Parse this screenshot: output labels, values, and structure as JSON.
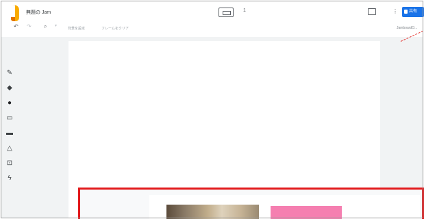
{
  "app": {
    "doc_title": "無題の Jam",
    "slide_count": "1"
  },
  "toolbar": {
    "undo_icon": "undo-icon",
    "redo_icon": "redo-icon",
    "zoom_icon": "zoom-icon",
    "set_background_label": "背景を設定",
    "clear_frame_label": "フレームをクリア",
    "right_label": "JamboardO..."
  },
  "header": {
    "share_label": "共有"
  },
  "colors": {
    "share": "#1a73e8",
    "highlight": "#e2191b",
    "pink": "#f57fb0"
  },
  "tools": [
    {
      "name": "pen",
      "glyph": "✎"
    },
    {
      "name": "eraser",
      "glyph": "◆"
    },
    {
      "name": "select",
      "glyph": "●"
    },
    {
      "name": "sticky-note",
      "glyph": "▭"
    },
    {
      "name": "image",
      "glyph": "▬"
    },
    {
      "name": "shape",
      "glyph": "△"
    },
    {
      "name": "text-box",
      "glyph": "⊡"
    },
    {
      "name": "laser",
      "glyph": "ϟ"
    }
  ]
}
